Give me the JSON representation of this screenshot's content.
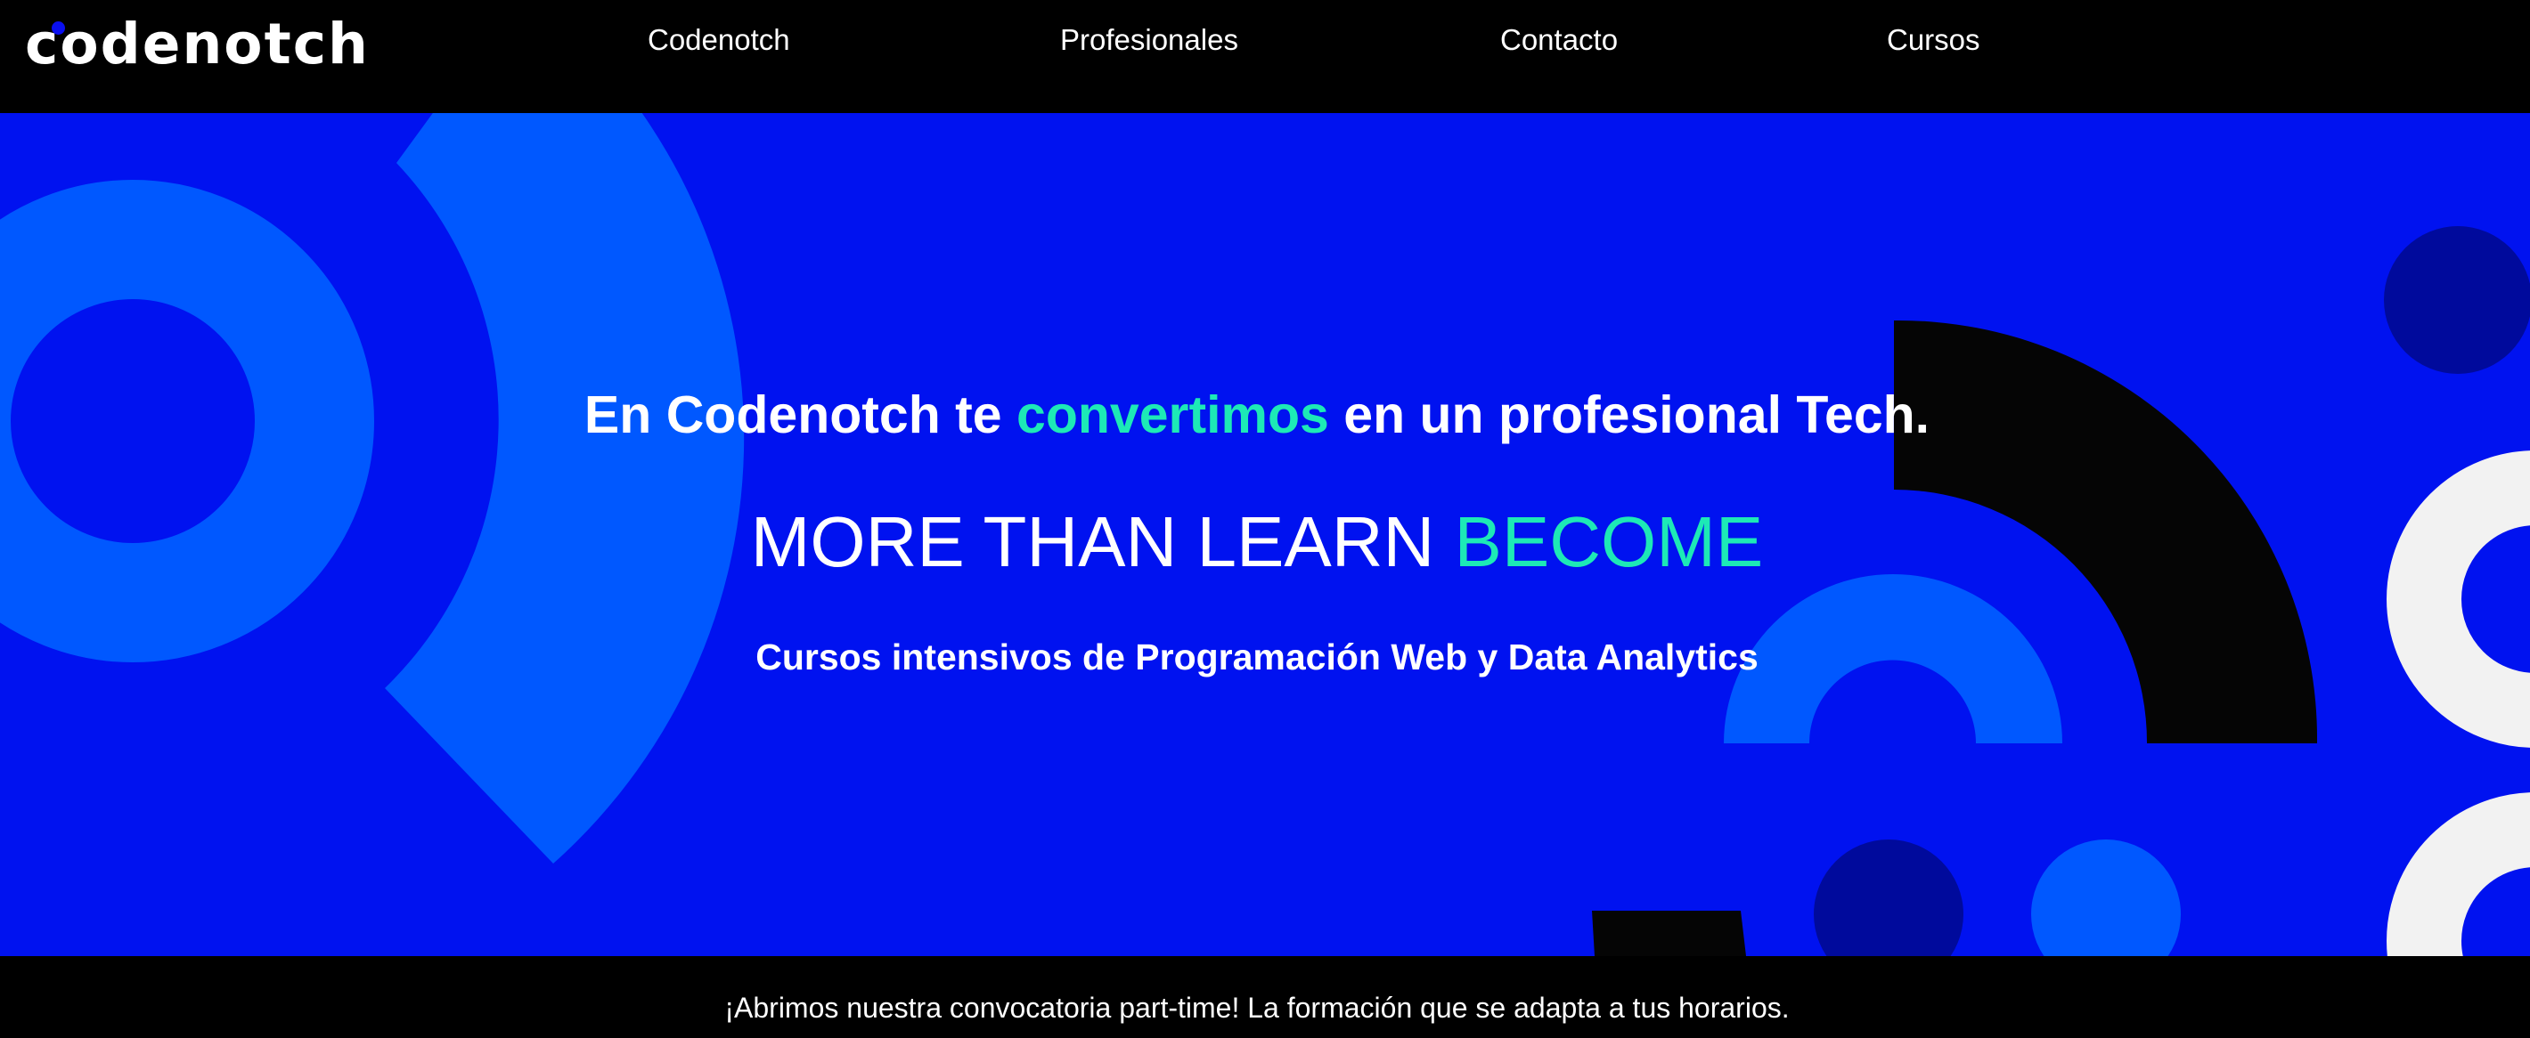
{
  "brand": {
    "logo_text": "codenotch"
  },
  "nav": {
    "items": [
      {
        "label": "Codenotch"
      },
      {
        "label": "Profesionales"
      },
      {
        "label": "Contacto"
      },
      {
        "label": "Cursos"
      }
    ]
  },
  "hero": {
    "line1_pre": "En Codenotch te ",
    "line1_accent": "convertimos",
    "line1_post": " en un profesional Tech.",
    "line2_main": "MORE THAN LEARN ",
    "line2_accent": "BECOME",
    "line3": "Cursos intensivos de Programación Web y Data Analytics"
  },
  "banner": {
    "text": "¡Abrimos nuestra convocatoria part-time! La formación que se adapta a tus horarios."
  },
  "colors": {
    "hero_background": "#0012f0",
    "accent_green": "#1de9b6",
    "shape_light_blue": "#0058ff",
    "shape_dark_navy": "#000a9c",
    "shape_black": "#050505",
    "shape_white": "#f2f2f2",
    "bar_background": "#000000"
  },
  "icons": [
    "codenotch-logo"
  ]
}
